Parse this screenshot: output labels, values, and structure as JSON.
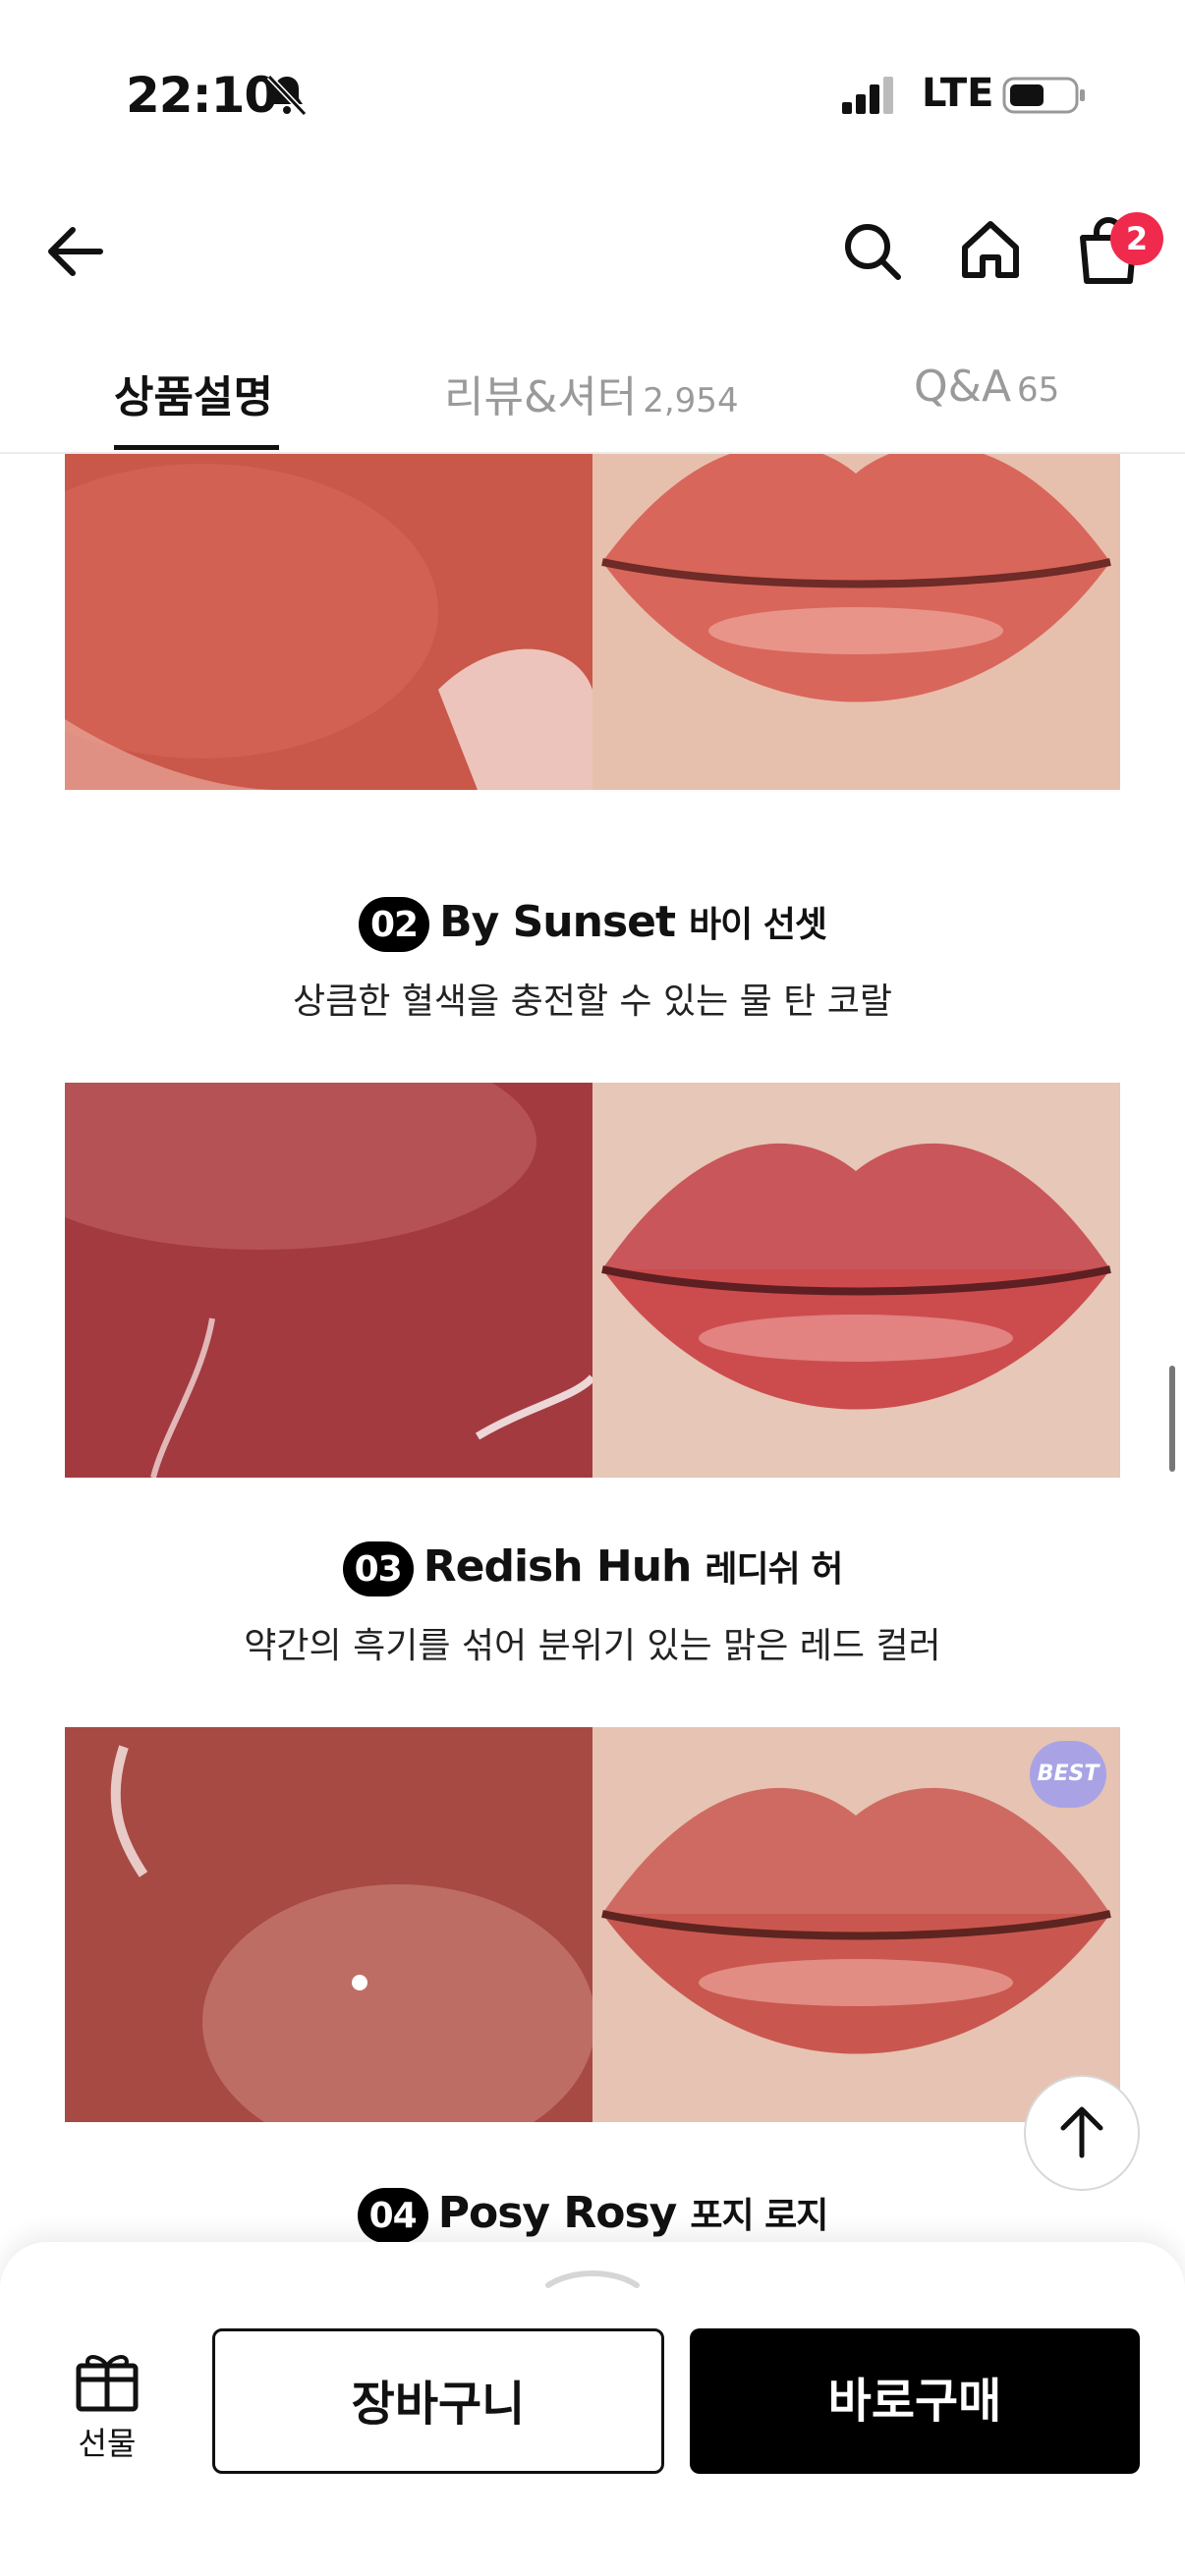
{
  "status_bar": {
    "time": "22:10",
    "network": "LTE"
  },
  "header": {
    "icons": [
      "back-arrow-icon",
      "search-icon",
      "home-icon",
      "shopping-bag-icon"
    ],
    "cart_count": "2"
  },
  "tabs": [
    {
      "label": "상품설명",
      "count": "",
      "active": true
    },
    {
      "label": "리뷰&셔터",
      "count": "2,954",
      "active": false
    },
    {
      "label": "Q&A",
      "count": "65",
      "active": false
    }
  ],
  "shades": [
    {
      "num": "",
      "name_en": "",
      "name_ko": "",
      "desc": "",
      "swatch_color": "#c9574a",
      "lip_color": "#d9665b",
      "best": false
    },
    {
      "num": "02",
      "name_en": "By Sunset",
      "name_ko": "바이 선셋",
      "desc": "상큼한 혈색을 충전할 수 있는 물 탄 코랄",
      "swatch_color": "#a33a3f",
      "lip_color": "#cc4c4e",
      "best": false
    },
    {
      "num": "03",
      "name_en": "Redish Huh",
      "name_ko": "레디쉬 허",
      "desc": "약간의 흑기를 섞어 분위기 있는 맑은 레드 컬러",
      "swatch_color": "#a64a43",
      "lip_color": "#c9574f",
      "best": true
    },
    {
      "num": "04",
      "name_en": "Posy Rosy",
      "name_ko": "포지 로지",
      "desc": "",
      "swatch_color": "#b3504a",
      "lip_color": "#cf6a62",
      "best": false
    }
  ],
  "best_label": "BEST",
  "bottom_bar": {
    "gift_label": "선물",
    "cart_button": "장바구니",
    "buy_button": "바로구매"
  }
}
